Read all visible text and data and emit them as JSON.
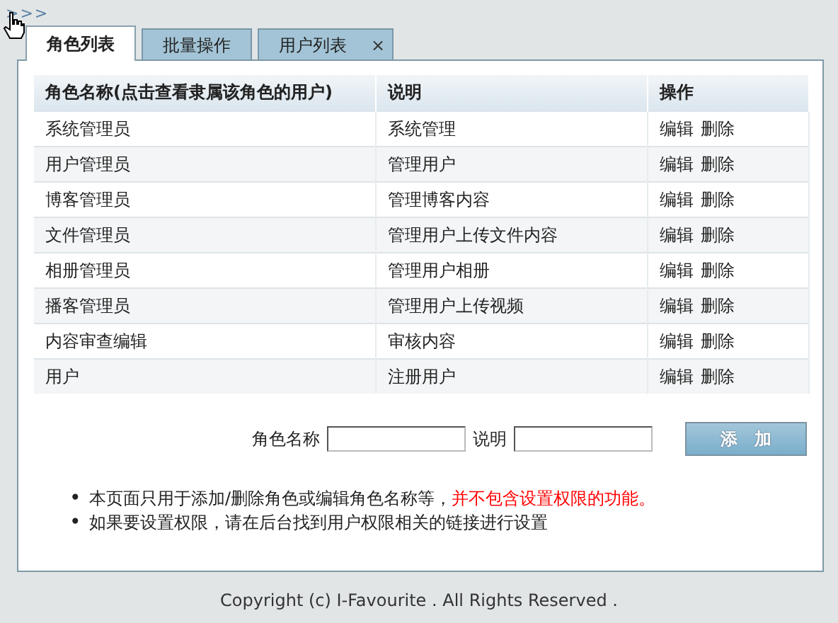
{
  "toggle": ">>>",
  "tabs": [
    {
      "label": "角色列表",
      "selected": true
    },
    {
      "label": "批量操作",
      "selected": false
    },
    {
      "label": "用户列表",
      "selected": false,
      "close": "×"
    }
  ],
  "table": {
    "columns": [
      "角色名称(点击查看隶属该角色的用户)",
      "说明",
      "操作"
    ],
    "rows": [
      {
        "name": "系统管理员",
        "desc": "系统管理",
        "actions": [
          "编辑",
          "删除"
        ]
      },
      {
        "name": "用户管理员",
        "desc": "管理用户",
        "actions": [
          "编辑",
          "删除"
        ]
      },
      {
        "name": "博客管理员",
        "desc": "管理博客内容",
        "actions": [
          "编辑",
          "删除"
        ]
      },
      {
        "name": "文件管理员",
        "desc": "管理用户上传文件内容",
        "actions": [
          "编辑",
          "删除"
        ]
      },
      {
        "name": "相册管理员",
        "desc": "管理用户相册",
        "actions": [
          "编辑",
          "删除"
        ]
      },
      {
        "name": "播客管理员",
        "desc": "管理用户上传视频",
        "actions": [
          "编辑",
          "删除"
        ]
      },
      {
        "name": "内容审查编辑",
        "desc": "审核内容",
        "actions": [
          "编辑",
          "删除"
        ]
      },
      {
        "name": "用户",
        "desc": "注册用户",
        "actions": [
          "编辑",
          "删除"
        ]
      }
    ]
  },
  "form": {
    "name_label": "角色名称",
    "desc_label": "说明",
    "button": "添　加"
  },
  "notes": [
    {
      "bullet": "•",
      "parts": [
        {
          "text": "本页面只用于添加/删除角色或编辑角色名称等，",
          "highlight": false
        },
        {
          "text": "并不包含设置权限的功能。",
          "highlight": true
        }
      ]
    },
    {
      "bullet": "•",
      "parts": [
        {
          "text": "如果要设置权限，请在后台找到用户权限相关的链接进行设置",
          "highlight": false
        }
      ]
    }
  ],
  "footer": "Copyright (c) I-Favourite . All Rights Reserved ."
}
